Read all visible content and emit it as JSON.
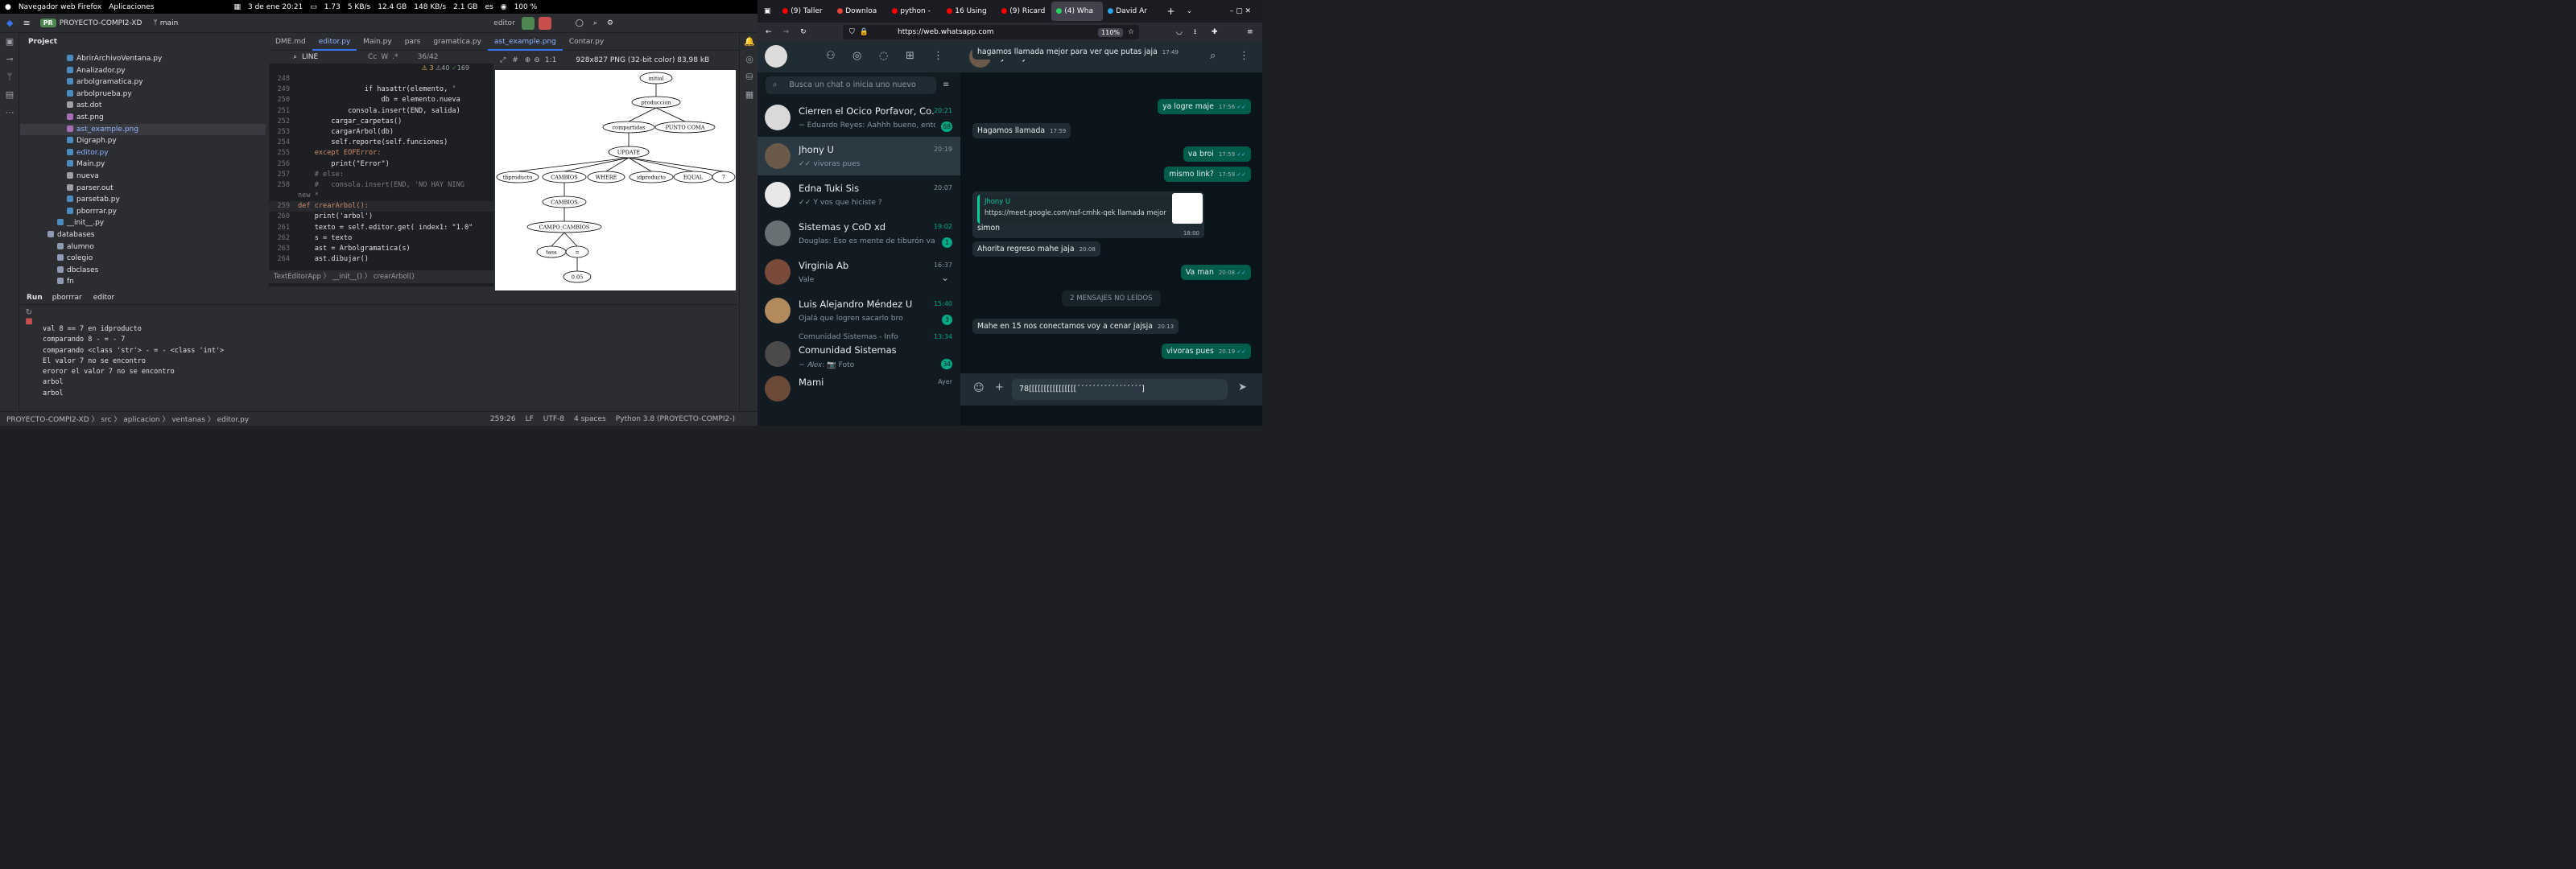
{
  "system_bar": {
    "app_menu": "Navegador web Firefox",
    "apps_menu": "Aplicaciones",
    "date": "3 de ene  20:21",
    "cpu": "1.73",
    "net_up": "5 KB/s",
    "disk": "12.4 GB",
    "net_down": "148 KB/s",
    "ram": "2.1 GB",
    "layout": "es",
    "battery": "100 %"
  },
  "ide": {
    "project_badge": "PR",
    "project_name": "PROYECTO-COMPI2-XD",
    "branch": "main",
    "run_config": "editor",
    "panel_title": "Project",
    "tree": [
      {
        "name": "AbrirArchivoVentana.py",
        "type": "py",
        "indent": 3
      },
      {
        "name": "Analizador.py",
        "type": "py",
        "indent": 3
      },
      {
        "name": "arbolgramatica.py",
        "type": "py",
        "indent": 3
      },
      {
        "name": "arbolprueba.py",
        "type": "py",
        "indent": 3
      },
      {
        "name": "ast.dot",
        "type": "file",
        "indent": 3
      },
      {
        "name": "ast.png",
        "type": "img",
        "indent": 3
      },
      {
        "name": "ast_example.png",
        "type": "img",
        "indent": 3,
        "selected": true
      },
      {
        "name": "Digraph.py",
        "type": "py",
        "indent": 3
      },
      {
        "name": "editor.py",
        "type": "py",
        "indent": 3
      },
      {
        "name": "Main.py",
        "type": "py",
        "indent": 3
      },
      {
        "name": "nueva",
        "type": "file",
        "indent": 3
      },
      {
        "name": "parser.out",
        "type": "file",
        "indent": 3
      },
      {
        "name": "parsetab.py",
        "type": "py",
        "indent": 3
      },
      {
        "name": "pborrrar.py",
        "type": "py",
        "indent": 3
      },
      {
        "name": "__init__.py",
        "type": "py",
        "indent": 2
      },
      {
        "name": "databases",
        "type": "folder",
        "indent": 1
      },
      {
        "name": "alumno",
        "type": "folder",
        "indent": 2
      },
      {
        "name": "colegio",
        "type": "folder",
        "indent": 2
      },
      {
        "name": "dbclases",
        "type": "folder",
        "indent": 2
      },
      {
        "name": "fn",
        "type": "folder",
        "indent": 2
      }
    ],
    "tabs": [
      "DME.md",
      "editor.py",
      "Main.py",
      "pars",
      "gramatica.py",
      "ast_example.png",
      "Contar.py"
    ],
    "active_tabs": [
      "editor.py",
      "ast_example.png"
    ],
    "search_text": "LINE",
    "search_count": "36/42",
    "inspection": {
      "warnings": "3",
      "weak": "40",
      "typos": "169"
    },
    "code": [
      {
        "n": "248",
        "t": ""
      },
      {
        "n": "249",
        "t": "                if hasattr(elemento, '"
      },
      {
        "n": "250",
        "t": "                    db = elemento.nueva"
      },
      {
        "n": "251",
        "t": "            consola.insert(END, salida)"
      },
      {
        "n": "252",
        "t": "        cargar_carpetas()"
      },
      {
        "n": "253",
        "t": "        cargarArbol(db)"
      },
      {
        "n": "254",
        "t": "        self.reporte(self.funciones)"
      },
      {
        "n": "255",
        "t": "    except EOFError:"
      },
      {
        "n": "256",
        "t": "        print(\"Error\")"
      },
      {
        "n": "257",
        "t": "    # else:"
      },
      {
        "n": "258",
        "t": "    #   consola.insert(END, 'NO HAY NING"
      },
      {
        "n": "",
        "t": "new *"
      },
      {
        "n": "259",
        "t": "def crearArbol():"
      },
      {
        "n": "260",
        "t": "    print('arbol')"
      },
      {
        "n": "261",
        "t": "    texto = self.editor.get( index1: \"1.0\""
      },
      {
        "n": "262",
        "t": "    s = texto"
      },
      {
        "n": "263",
        "t": "    ast = Arbolgramatica(s)"
      },
      {
        "n": "264",
        "t": "    ast.dibujar()"
      }
    ],
    "breadcrumb": [
      "TextEditorApp",
      "__init__()",
      "crearArbol()"
    ],
    "image_info": "928x827 PNG (32-bit color) 83,98 kB",
    "zoom_label": "1:1",
    "run_title": "Run",
    "run_tabs": [
      "pborrrar",
      "editor"
    ],
    "console": [
      "val 8 == 7 en idproducto",
      "comparando 8 - = - 7",
      "comparando <class 'str'> - = - <class 'int'>",
      "El valor 7 no se encontro",
      "eroror el valor 7 no se encontro",
      "arbol",
      "arbol"
    ],
    "status_path": [
      "PROYECTO-COMPI2-XD",
      "src",
      "aplicacion",
      "ventanas",
      "editor.py"
    ],
    "status_right": {
      "pos": "259:26",
      "eol": "LF",
      "enc": "UTF-8",
      "indent": "4 spaces",
      "interp": "Python 3.8 (PROYECTO-COMPI2-)"
    }
  },
  "tree_diagram": {
    "nodes": [
      "initial",
      "produccion",
      "compartidas",
      "PUNTO COMA",
      "UPDATE",
      "tbproducto",
      "CAMBIOS",
      "WHERE",
      "idproducto",
      "EQUAL",
      "7",
      "CAMBIOS",
      "CAMPO_CAMBIOS",
      "tasa",
      "=",
      "0.05"
    ]
  },
  "firefox": {
    "tabs": [
      "(9) Taller",
      "Downloa",
      "python -",
      "16 Using",
      "(9) Ricard",
      "(4) Wha",
      "David Ar"
    ],
    "active_tab": 5,
    "url": "https://web.whatsapp.com",
    "zoom": "110%"
  },
  "whatsapp": {
    "search_placeholder": "Busca un chat o inicia uno nuevo",
    "chats": [
      {
        "name": "Cierren el Ocico Porfavor, Co...",
        "preview": "~ Eduardo Reyes: Aahhh bueno, enton...",
        "time": "20:21",
        "badge": "68",
        "unread": true,
        "color": "#d9d9d9"
      },
      {
        "name": "Jhony U",
        "preview": "✓✓ vivoras pues",
        "time": "20:19",
        "badge": "",
        "unread": false,
        "selected": true,
        "color": "#6b5a4a"
      },
      {
        "name": "Edna Tuki Sis",
        "preview": "✓✓ Y vos que hiciste ?",
        "time": "20:07",
        "badge": "",
        "unread": false,
        "color": "#e8e8e8"
      },
      {
        "name": "Sistemas y CoD xd",
        "preview": "Douglas: Eso es mente de tiburón va ...",
        "time": "19:02",
        "badge": "1",
        "unread": true,
        "color": "#6a7175"
      },
      {
        "name": "Virginia Ab",
        "preview": "Vale",
        "time": "16:37",
        "badge": "",
        "unread": false,
        "color": "#7a4b3a"
      },
      {
        "name": "Luis Alejandro Méndez U",
        "preview": "Ojalá que logren sacarlo bro",
        "time": "15:40",
        "badge": "3",
        "unread": true,
        "color": "#b38a5e"
      },
      {
        "name": "Comunidad Sistemas",
        "preview": "~ 𝐴𝑙𝑒𝑥: 📷 Foto",
        "community": "Comunidad Sistemas - Info",
        "time": "13:34",
        "badge": "34",
        "unread": true,
        "color": "#4a4a4a"
      },
      {
        "name": "Mami",
        "preview": "",
        "time": "Ayer",
        "badge": "",
        "unread": false,
        "color": "#6b4a3a"
      }
    ],
    "contact_name": "Jhony U",
    "messages": [
      {
        "text": "hagamos llamada mejor para ver que putas jaja",
        "time": "17:49",
        "dir": "in"
      },
      {
        "text": "ya logre maje",
        "time": "17:56",
        "dir": "out"
      },
      {
        "text": "Hagamos llamada",
        "time": "17:59",
        "dir": "in"
      },
      {
        "text": "va broi",
        "time": "17:59",
        "dir": "out"
      },
      {
        "text": "mismo  link?",
        "time": "17:59",
        "dir": "out"
      },
      {
        "text": "simon",
        "time": "18:00",
        "dir": "in",
        "quote_author": "Jhony U",
        "quote_text": "https://meet.google.com/nsf-cmhk-qek llamada mejor jaja"
      },
      {
        "text": "Ahorita regreso mahe jaja",
        "time": "20:08",
        "dir": "in"
      },
      {
        "text": "Va man",
        "time": "20:08",
        "dir": "out"
      },
      {
        "text": "Mahe en 15 nos conectamos voy a cenar jajsja",
        "time": "20:13",
        "dir": "in"
      },
      {
        "text": "vivoras pues",
        "time": "20:19",
        "dir": "out"
      }
    ],
    "unread_divider": "2 MENSAJES NO LEÍDOS",
    "compose_text": "78[[[[[[[[[[[[[[[[´´´´´´´´´´´´´´´´´]"
  },
  "colors": {
    "accent": "#00a884",
    "ide_bg": "#1e1f22",
    "wa_bg": "#0b141a"
  }
}
